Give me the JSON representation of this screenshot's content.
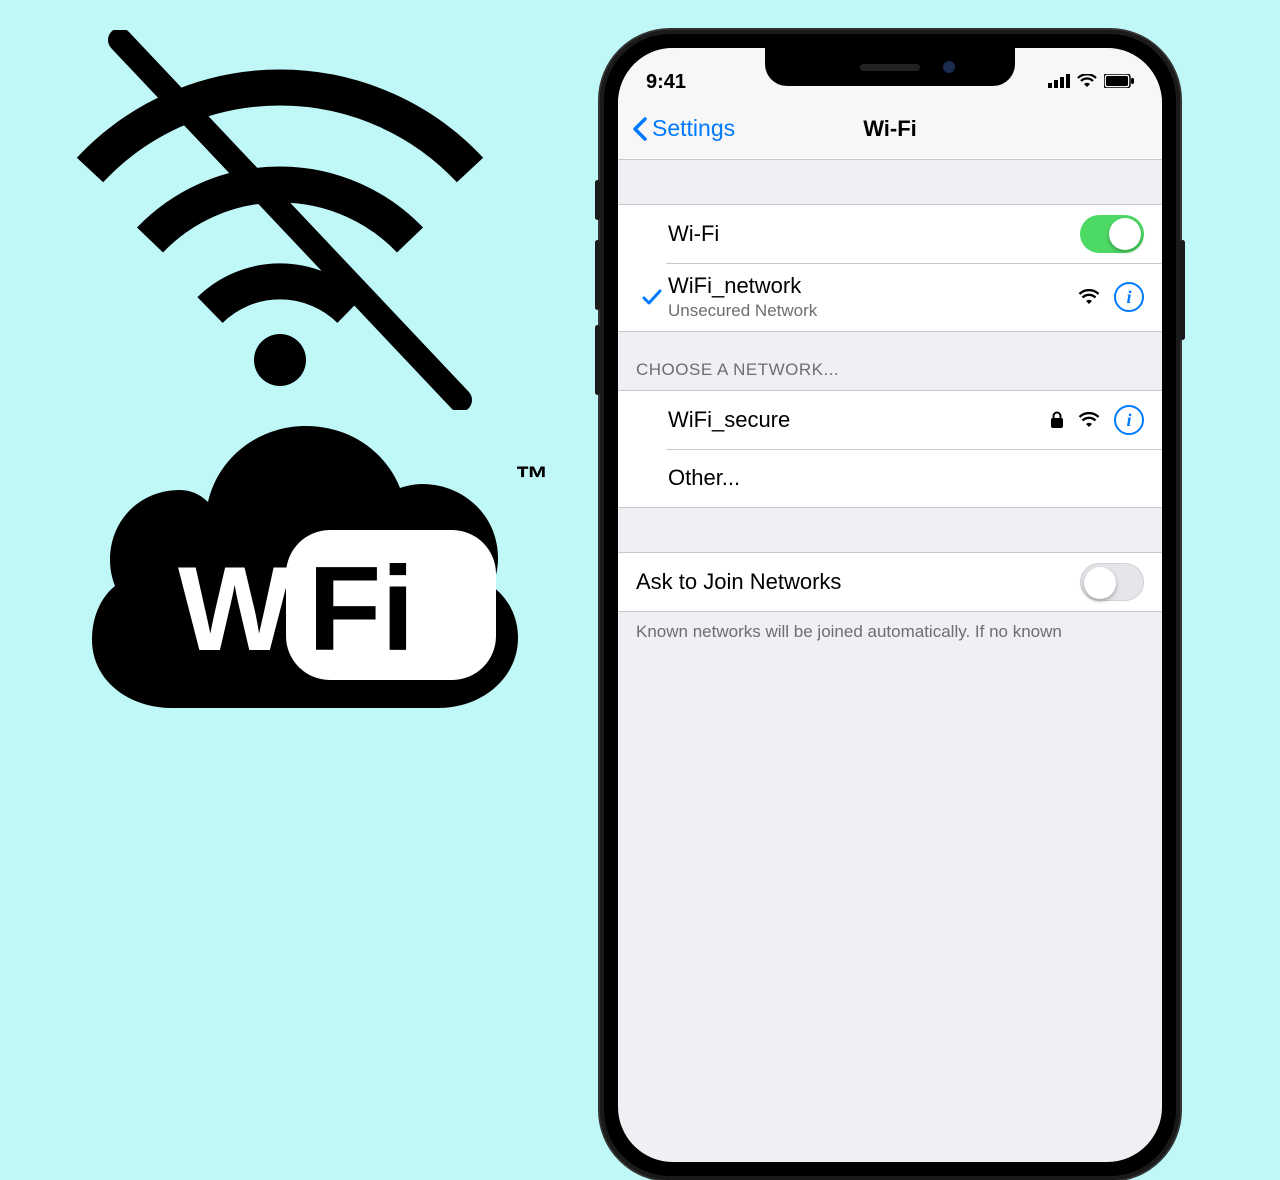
{
  "status_bar": {
    "time": "9:41"
  },
  "nav": {
    "back_label": "Settings",
    "title": "Wi-Fi"
  },
  "wifi_toggle": {
    "label": "Wi-Fi",
    "on": true
  },
  "connected": {
    "name": "WiFi_network",
    "subtitle": "Unsecured Network",
    "secured": false
  },
  "choose_header": "CHOOSE A NETWORK...",
  "networks": [
    {
      "name": "WiFi_secure",
      "secured": true
    }
  ],
  "other_label": "Other...",
  "ask_join": {
    "label": "Ask to Join Networks",
    "on": false
  },
  "footer": "Known networks will be joined automatically. If no known",
  "tm_label": "™"
}
